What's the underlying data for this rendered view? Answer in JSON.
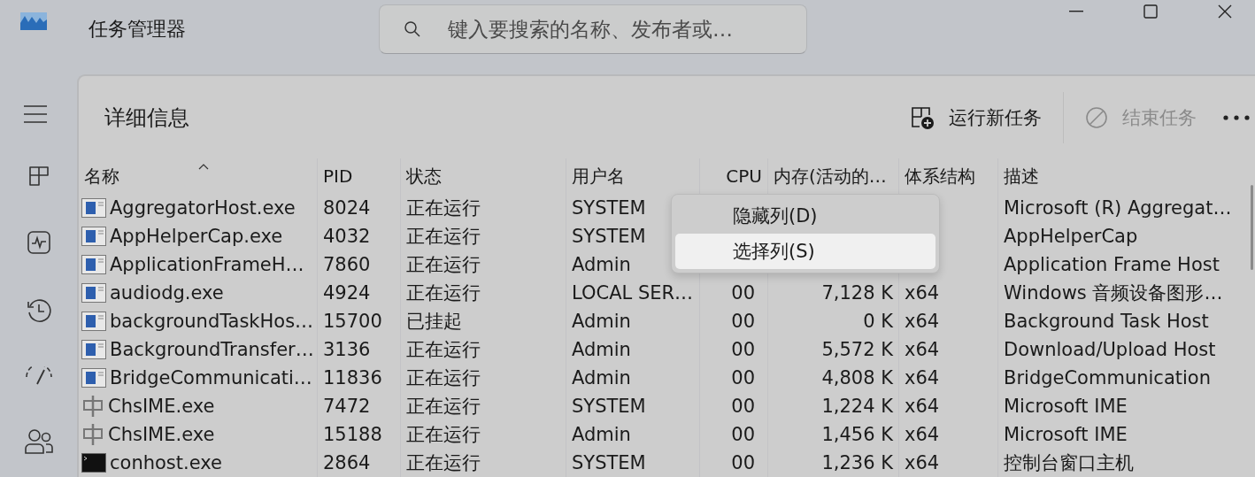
{
  "window": {
    "title": "任务管理器"
  },
  "search": {
    "placeholder": "键入要搜索的名称、发布者或…"
  },
  "page": {
    "title": "详细信息"
  },
  "toolbar": {
    "run_new_task": {
      "label": "运行新任务",
      "disabled": false
    },
    "end_task": {
      "label": "结束任务",
      "disabled": true
    }
  },
  "table": {
    "columns": [
      {
        "label": "名称",
        "sorted": true
      },
      {
        "label": "PID",
        "sorted": false
      },
      {
        "label": "状态",
        "sorted": false
      },
      {
        "label": "用户名",
        "sorted": false
      },
      {
        "label": "CPU",
        "sorted": false
      },
      {
        "label": "内存(活动的…",
        "sorted": false
      },
      {
        "label": "体系结构",
        "sorted": false
      },
      {
        "label": "描述",
        "sorted": false
      }
    ],
    "rows": [
      {
        "kind": "app",
        "name": "AggregatorHost.exe",
        "pid": "8024",
        "status": "正在运行",
        "user": "SYSTEM",
        "description": "Microsoft (R) Aggregat…"
      },
      {
        "kind": "app",
        "name": "AppHelperCap.exe",
        "pid": "4032",
        "status": "正在运行",
        "user": "SYSTEM",
        "description": "AppHelperCap"
      },
      {
        "kind": "app",
        "name": "ApplicationFrameH…",
        "pid": "7860",
        "status": "正在运行",
        "user": "Admin",
        "description": "Application Frame Host"
      },
      {
        "kind": "app",
        "name": "audiodg.exe",
        "pid": "4924",
        "status": "正在运行",
        "user": "LOCAL SER…",
        "cpu": "00",
        "memory": "7,128 K",
        "arch": "x64",
        "description": "Windows 音频设备图形…"
      },
      {
        "kind": "app",
        "name": "backgroundTaskHos…",
        "pid": "15700",
        "status": "已挂起",
        "user": "Admin",
        "cpu": "00",
        "memory": "0 K",
        "arch": "x64",
        "description": "Background Task Host"
      },
      {
        "kind": "app",
        "name": "BackgroundTransfer…",
        "pid": "3136",
        "status": "正在运行",
        "user": "Admin",
        "cpu": "00",
        "memory": "5,572 K",
        "arch": "x64",
        "description": "Download/Upload Host"
      },
      {
        "kind": "app",
        "name": "BridgeCommunicati…",
        "pid": "11836",
        "status": "正在运行",
        "user": "Admin",
        "cpu": "00",
        "memory": "4,808 K",
        "arch": "x64",
        "description": "BridgeCommunication"
      },
      {
        "kind": "ime",
        "name": "ChsIME.exe",
        "pid": "7472",
        "status": "正在运行",
        "user": "SYSTEM",
        "cpu": "00",
        "memory": "1,224 K",
        "arch": "x64",
        "description": "Microsoft IME"
      },
      {
        "kind": "ime",
        "name": "ChsIME.exe",
        "pid": "15188",
        "status": "正在运行",
        "user": "Admin",
        "cpu": "00",
        "memory": "1,456 K",
        "arch": "x64",
        "description": "Microsoft IME"
      },
      {
        "kind": "console",
        "name": "conhost.exe",
        "pid": "2864",
        "status": "正在运行",
        "user": "SYSTEM",
        "cpu": "00",
        "memory": "1,236 K",
        "arch": "x64",
        "description": "控制台窗口主机"
      }
    ]
  },
  "context_menu": {
    "items": [
      {
        "label": "隐藏列(D)",
        "selected": false
      },
      {
        "label": "选择列(S)",
        "selected": true
      }
    ]
  }
}
